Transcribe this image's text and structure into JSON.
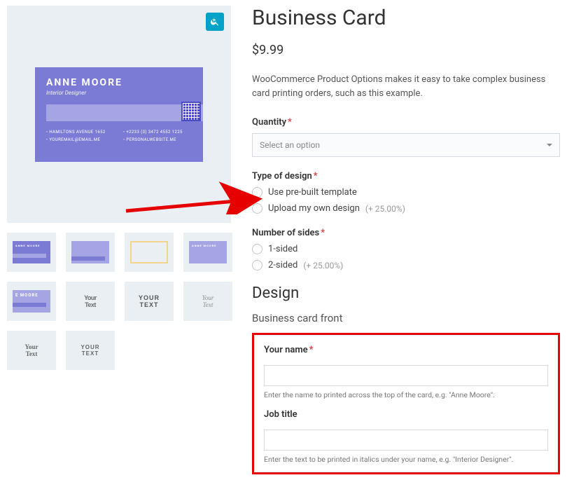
{
  "product": {
    "title": "Business Card",
    "price": "$9.99",
    "description": "WooCommerce Product Options makes it easy to take complex business card printing orders, such as this example."
  },
  "preview_card": {
    "name": "ANNE MOORE",
    "title": "Interior Designer",
    "contacts": {
      "address": "HAMILTONS AVENUE 1652",
      "phone": "+2233 (0) 3472 4552 1225",
      "email": "YOUREMAIL@EMAIL.ME",
      "site": "PERSONALWEBSITE.ME"
    }
  },
  "thumbs": {
    "mini_name": "ANNE MOORE",
    "mini_name_short": "E MOORE",
    "t_yourtext": "Your\nText",
    "t_yourtext_block": "Your\ntext",
    "t_yourtext_scratch": "Your\nText",
    "t_yourtext_caps": "YOUR\nTEXT"
  },
  "options": {
    "quantity": {
      "label": "Quantity",
      "placeholder": "Select an option"
    },
    "design_type": {
      "label": "Type of design",
      "opt1": "Use pre-built template",
      "opt2": "Upload my own design",
      "opt2_surcharge": "(+ 25.00%)"
    },
    "sides": {
      "label": "Number of sides",
      "opt1": "1-sided",
      "opt2": "2-sided",
      "opt2_surcharge": "(+ 25.00%)"
    }
  },
  "design": {
    "section": "Design",
    "subsection": "Business card front",
    "name": {
      "label": "Your name",
      "hint": "Enter the name to printed across the top of the card, e.g. \"Anne Moore\"."
    },
    "job": {
      "label": "Job title",
      "hint": "Enter the text to be printed in italics under your name, e.g. \"Interior Designer\"."
    }
  }
}
